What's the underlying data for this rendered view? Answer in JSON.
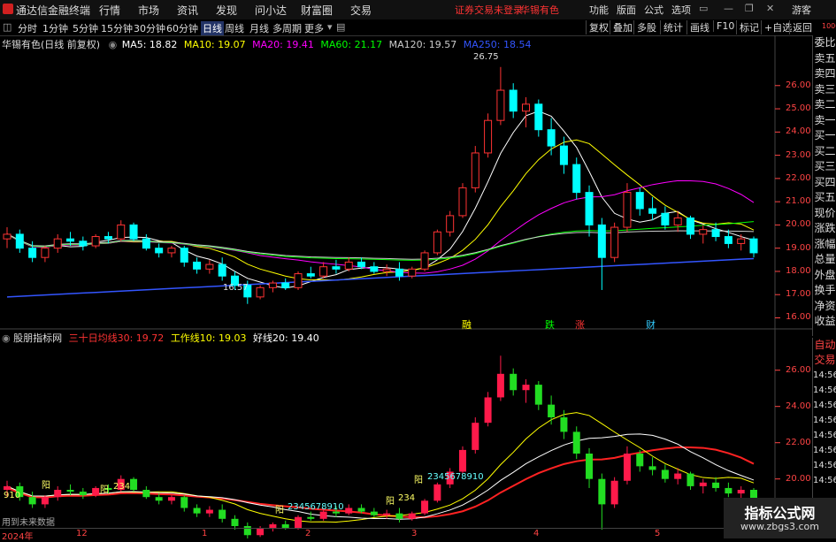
{
  "titlebar": {
    "app_title": "通达信金融终端",
    "menus": [
      "行情",
      "市场",
      "资讯",
      "发现",
      "问小达",
      "财富圈",
      "交易"
    ],
    "alert": "证券交易未登录",
    "stock": "华锡有色",
    "right_items": [
      "功能",
      "版面",
      "公式",
      "选项"
    ],
    "guest": "游客"
  },
  "toolbar": {
    "timeframes": [
      "分时",
      "1分钟",
      "5分钟",
      "15分钟",
      "30分钟",
      "60分钟",
      "日线",
      "周线",
      "月线",
      "多周期",
      "更多"
    ],
    "active": "日线",
    "right_buttons": [
      "复权",
      "叠加",
      "多股",
      "统计",
      "画线",
      "F10",
      "标记",
      "+自选",
      "返回"
    ]
  },
  "main_chart": {
    "title": "华锡有色(日线 前复权)",
    "indicators": [
      {
        "label": "MA5: 18.82",
        "color": "#ffffff"
      },
      {
        "label": "MA10: 19.07",
        "color": "#ffff00"
      },
      {
        "label": "MA20: 19.41",
        "color": "#ff00ff"
      },
      {
        "label": "MA60: 21.17",
        "color": "#00ff00"
      },
      {
        "label": "MA120: 19.57",
        "color": "#cccccc"
      },
      {
        "label": "MA250: 18.54",
        "color": "#3355ff"
      }
    ],
    "high_label": "26.75",
    "low_label": "16.57",
    "y_ticks": [
      "26.00",
      "25.00",
      "24.00",
      "23.00",
      "22.00",
      "21.00",
      "20.00",
      "19.00",
      "18.00",
      "17.00",
      "16.00"
    ],
    "y_range": [
      15.6,
      27.4
    ],
    "event_marks": [
      {
        "label": "融",
        "color": "#ffff00"
      },
      {
        "label": "跌",
        "color": "#00ff00"
      },
      {
        "label": "涨",
        "color": "#ff3333"
      },
      {
        "label": "财",
        "color": "#33ccff"
      }
    ]
  },
  "sub_chart": {
    "title": "股朋指标网",
    "indicators": [
      {
        "label": "三十日均线30: 19.72",
        "color": "#ff3333"
      },
      {
        "label": "工作线10: 19.03",
        "color": "#ffff00"
      },
      {
        "label": "好线20: 19.40",
        "color": "#ffffff"
      }
    ],
    "y_ticks": [
      "26.00",
      "24.00",
      "22.00",
      "20.00",
      "18.00"
    ],
    "y_range": [
      17.4,
      27.4
    ],
    "texts": [
      "910",
      "阳",
      "234",
      "阳",
      "2345678910",
      "阳",
      "234",
      "阳",
      "2345678910",
      "阳"
    ],
    "footer_note": "用到未来数据"
  },
  "x_axis": {
    "labels": [
      "2024年",
      "12",
      "1",
      "2",
      "3",
      "4",
      "5"
    ]
  },
  "right_panel": {
    "top_items": [
      "委比",
      "卖五",
      "卖四",
      "卖三",
      "卖二",
      "卖一",
      "买一",
      "买二",
      "买三",
      "买四",
      "买五",
      "现价",
      "涨跌",
      "涨幅",
      "总量",
      "外盘",
      "换手",
      "净资",
      "收益"
    ],
    "bottom_items": [
      "自动",
      "交易",
      "14:56",
      "14:56",
      "14:56",
      "14:56",
      "14:56",
      "14:56",
      "14:56",
      "14:56"
    ]
  },
  "watermark": {
    "title": "指标公式网",
    "url": "www.zbgs3.com"
  },
  "chart_data": {
    "type": "candlestick",
    "series": [
      {
        "name": "K",
        "values": [
          [
            19.4,
            19.9,
            19.0,
            19.6
          ],
          [
            19.6,
            19.8,
            18.8,
            19.0
          ],
          [
            19.0,
            19.3,
            18.4,
            18.6
          ],
          [
            18.6,
            19.1,
            18.4,
            19.0
          ],
          [
            19.0,
            19.6,
            18.8,
            19.4
          ],
          [
            19.4,
            19.7,
            19.1,
            19.3
          ],
          [
            19.3,
            19.5,
            18.9,
            19.1
          ],
          [
            19.1,
            19.6,
            19.0,
            19.5
          ],
          [
            19.5,
            19.7,
            19.2,
            19.4
          ],
          [
            19.4,
            20.2,
            19.3,
            20.0
          ],
          [
            20.0,
            20.1,
            19.3,
            19.4
          ],
          [
            19.4,
            19.6,
            18.9,
            19.0
          ],
          [
            19.0,
            19.2,
            18.6,
            18.8
          ],
          [
            18.8,
            19.1,
            18.6,
            19.0
          ],
          [
            19.0,
            19.1,
            18.2,
            18.4
          ],
          [
            18.4,
            18.6,
            17.9,
            18.1
          ],
          [
            18.1,
            18.5,
            17.9,
            18.3
          ],
          [
            18.3,
            18.6,
            17.6,
            17.8
          ],
          [
            17.8,
            18.0,
            17.2,
            17.4
          ],
          [
            17.4,
            17.6,
            16.6,
            16.9
          ],
          [
            16.9,
            17.4,
            16.8,
            17.3
          ],
          [
            17.3,
            17.6,
            17.1,
            17.5
          ],
          [
            17.5,
            17.7,
            17.2,
            17.3
          ],
          [
            17.3,
            18.0,
            17.2,
            17.9
          ],
          [
            17.9,
            18.2,
            17.7,
            17.8
          ],
          [
            17.8,
            18.4,
            17.7,
            18.2
          ],
          [
            18.2,
            18.5,
            17.9,
            18.1
          ],
          [
            18.1,
            18.6,
            18.0,
            18.4
          ],
          [
            18.4,
            18.6,
            18.1,
            18.2
          ],
          [
            18.2,
            18.4,
            17.9,
            18.0
          ],
          [
            18.0,
            18.3,
            17.8,
            18.1
          ],
          [
            18.1,
            18.4,
            17.6,
            17.8
          ],
          [
            17.8,
            18.2,
            17.7,
            18.1
          ],
          [
            18.1,
            18.9,
            18.0,
            18.8
          ],
          [
            18.8,
            19.8,
            18.7,
            19.7
          ],
          [
            19.7,
            20.6,
            19.5,
            20.4
          ],
          [
            20.4,
            21.8,
            20.3,
            21.6
          ],
          [
            21.6,
            23.4,
            21.4,
            23.1
          ],
          [
            23.1,
            24.8,
            22.9,
            24.5
          ],
          [
            24.5,
            26.8,
            24.3,
            25.8
          ],
          [
            25.8,
            26.1,
            24.6,
            24.9
          ],
          [
            24.9,
            25.5,
            24.2,
            25.2
          ],
          [
            25.2,
            25.4,
            23.8,
            24.1
          ],
          [
            24.1,
            24.6,
            23.0,
            23.4
          ],
          [
            23.4,
            23.8,
            22.2,
            22.6
          ],
          [
            22.6,
            22.9,
            21.1,
            21.4
          ],
          [
            21.4,
            21.7,
            19.5,
            20.0
          ],
          [
            20.0,
            20.3,
            17.2,
            18.6
          ],
          [
            18.6,
            20.1,
            18.4,
            19.9
          ],
          [
            19.9,
            21.8,
            19.7,
            21.4
          ],
          [
            21.4,
            21.6,
            20.4,
            20.7
          ],
          [
            20.7,
            21.2,
            20.2,
            20.5
          ],
          [
            20.5,
            20.8,
            19.8,
            20.0
          ],
          [
            20.0,
            20.6,
            19.7,
            20.3
          ],
          [
            20.3,
            20.4,
            19.4,
            19.6
          ],
          [
            19.6,
            20.0,
            19.2,
            19.8
          ],
          [
            19.8,
            20.1,
            19.3,
            19.5
          ],
          [
            19.5,
            19.8,
            19.0,
            19.2
          ],
          [
            19.2,
            19.6,
            18.9,
            19.4
          ],
          [
            19.4,
            19.5,
            18.6,
            18.8
          ]
        ]
      }
    ]
  }
}
